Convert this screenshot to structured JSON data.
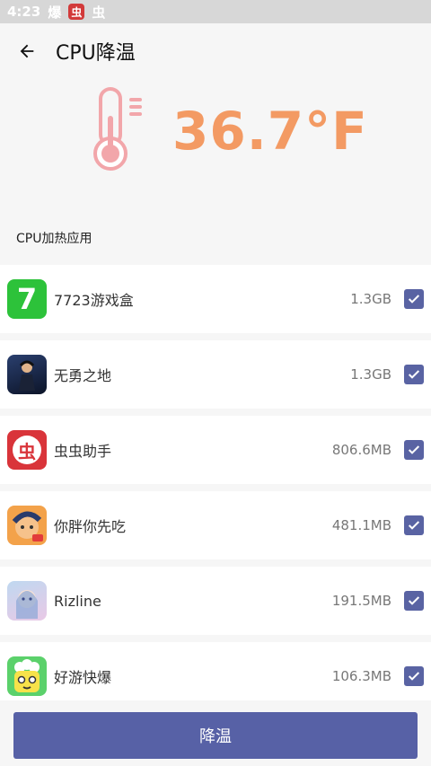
{
  "status_bar": {
    "time": "4:23",
    "icon1": "爆",
    "icon2": "虫",
    "icon3": "虫"
  },
  "header": {
    "title": "CPU降温"
  },
  "temperature": {
    "value": "36.7°F",
    "color": "#f39a63"
  },
  "section": {
    "label": "CPU加热应用"
  },
  "apps": [
    {
      "name": "7723游戏盒",
      "size": "1.3GB",
      "checked": true
    },
    {
      "name": "无勇之地",
      "size": "1.3GB",
      "checked": true
    },
    {
      "name": "虫虫助手",
      "size": "806.6MB",
      "checked": true
    },
    {
      "name": "你胖你先吃",
      "size": "481.1MB",
      "checked": true
    },
    {
      "name": "Rizline",
      "size": "191.5MB",
      "checked": true
    },
    {
      "name": "好游快爆",
      "size": "106.3MB",
      "checked": true
    }
  ],
  "icon_text": {
    "app1": "7",
    "app3": "虫"
  },
  "action": {
    "label": "降温"
  },
  "colors": {
    "accent": "#5761a6",
    "thermometer": "#f2a6aa"
  }
}
